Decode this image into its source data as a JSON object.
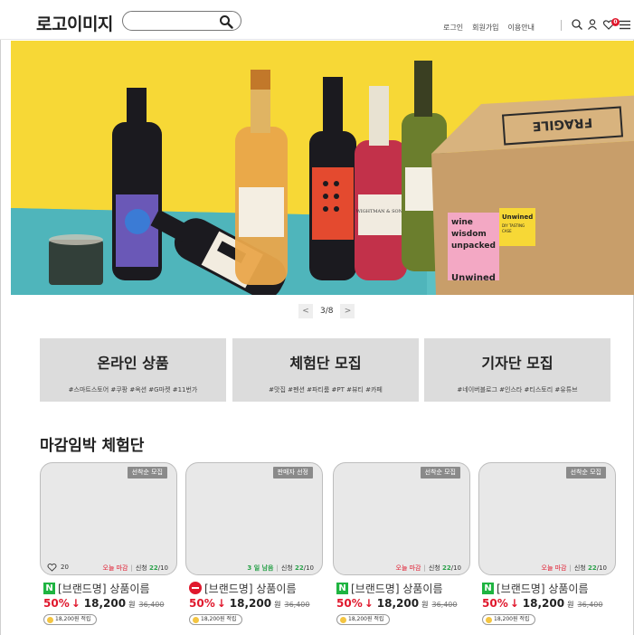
{
  "header": {
    "logo": "로고이미지",
    "search_placeholder": "",
    "nav": [
      "로그인",
      "회원가입",
      "이용안내"
    ],
    "cart_count": "0",
    "icons": [
      "search-icon",
      "user-icon",
      "heart-icon",
      "menu-icon"
    ]
  },
  "banner": {
    "pager_text": "3/8",
    "prev_label": "<",
    "next_label": ">",
    "box_text": "FRAGILE",
    "pink_label": [
      "wine",
      "wisdom",
      "unpacked"
    ],
    "yellow_label": [
      "Unwined",
      "DIY TASTING",
      "CASE"
    ],
    "bottom_label": "Unwined",
    "bottle_label": "WIGHTMAN & SONS"
  },
  "categories": [
    {
      "title": "온라인 상품",
      "tags": "#스마트스토어 #쿠팡 #옥션 #G마켓 #11번가"
    },
    {
      "title": "체험단 모집",
      "tags": "#맛집 #펜션 #파티룸 #PT #뷰티 #카페"
    },
    {
      "title": "기자단 모집",
      "tags": "#네이버블로그 #인스타 #티스토리 #유튜브"
    }
  ],
  "section_title": "마감임박 체험단",
  "products": [
    {
      "tag": "선착순 모집",
      "likes": "20",
      "deadline": "오늘 마감",
      "apply_prefix": "신청",
      "apply_count": "22",
      "apply_total": "/10",
      "badge": "N",
      "name": "[브랜드명] 상품이름",
      "discount": "50%",
      "arrow": "↓",
      "price": "18,200",
      "unit": "원",
      "original": "36,400",
      "points": "18,200원 적립"
    },
    {
      "tag": "판매자 선정",
      "likes": "",
      "deadline": "3 일 남음",
      "apply_prefix": "신청",
      "apply_count": "22",
      "apply_total": "/10",
      "badge": "channel",
      "name": "[브랜드명] 상품이름",
      "discount": "50%",
      "arrow": "↓",
      "price": "18,200",
      "unit": "원",
      "original": "36,400",
      "points": "18,200원 적립"
    },
    {
      "tag": "선착순 모집",
      "likes": "",
      "deadline": "오늘 마감",
      "apply_prefix": "신청",
      "apply_count": "22",
      "apply_total": "/10",
      "badge": "N",
      "name": "[브랜드명] 상품이름",
      "discount": "50%",
      "arrow": "↓",
      "price": "18,200",
      "unit": "원",
      "original": "36,400",
      "points": "18,200원 적립"
    },
    {
      "tag": "선착순 모집",
      "likes": "",
      "deadline": "오늘 마감",
      "apply_prefix": "신청",
      "apply_count": "22",
      "apply_total": "/10",
      "badge": "N",
      "name": "[브랜드명] 상품이름",
      "discount": "50%",
      "arrow": "↓",
      "price": "18,200",
      "unit": "원",
      "original": "36,400",
      "points": "18,200원 적립"
    }
  ],
  "colors": {
    "accent": "#e0182d",
    "naver_green": "#1fb441",
    "banner_yellow": "#f7d836",
    "banner_teal": "#5bc0c4"
  }
}
